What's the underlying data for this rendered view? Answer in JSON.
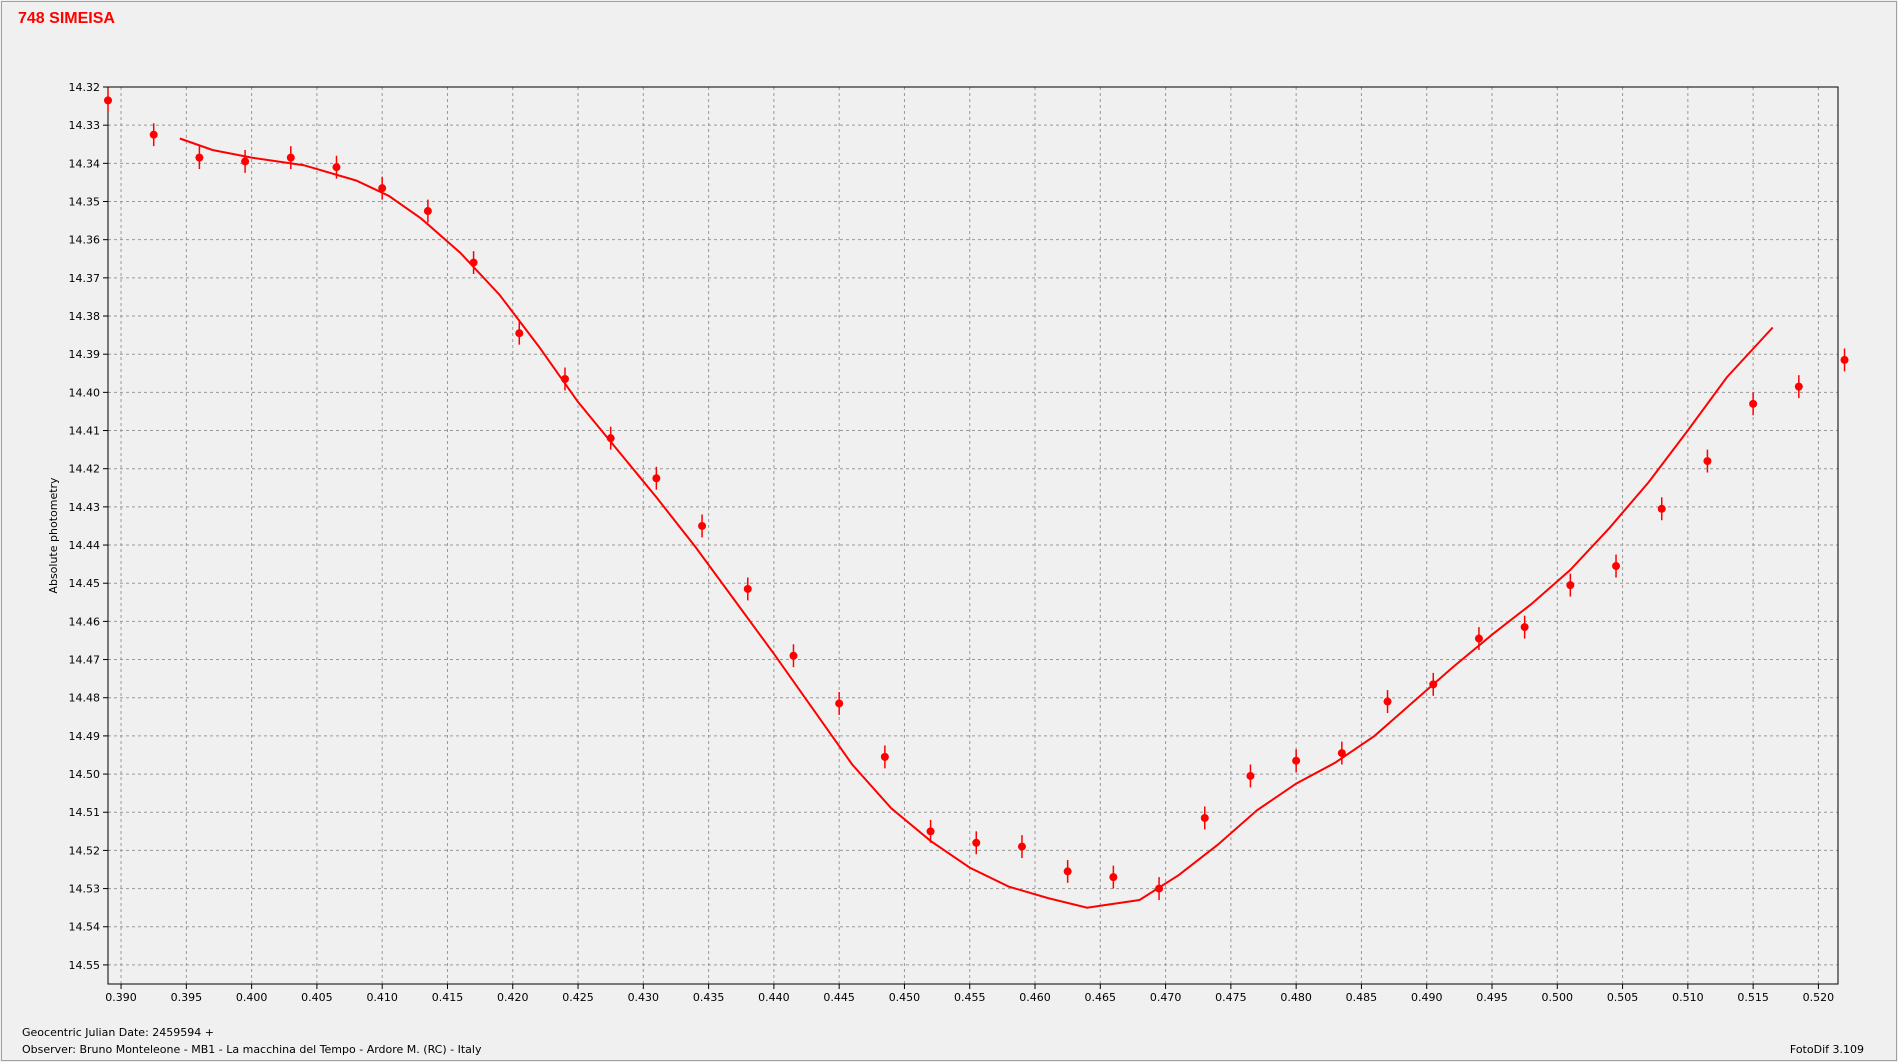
{
  "title": "748 SIMEISA",
  "footer": {
    "date_label": "Geocentric Julian Date: 2459594 +",
    "observer": "Observer: Bruno Monteleone - MB1 - La macchina del Tempo - Ardore M. (RC) - Italy",
    "software": "FotoDif 3.109"
  },
  "colors": {
    "series": "#ff0000",
    "grid": "#999999",
    "plot_bg": "#f0f0f0"
  },
  "chart_data": {
    "type": "scatter",
    "xlabel": "",
    "ylabel": "Absolute photometry",
    "xlim": [
      0.389,
      0.5215
    ],
    "ylim": [
      14.32,
      14.555
    ],
    "y_inverted": true,
    "grid": true,
    "x_ticks": [
      "0.390",
      "0.395",
      "0.400",
      "0.405",
      "0.410",
      "0.415",
      "0.420",
      "0.425",
      "0.430",
      "0.435",
      "0.440",
      "0.445",
      "0.450",
      "0.455",
      "0.460",
      "0.465",
      "0.470",
      "0.475",
      "0.480",
      "0.485",
      "0.490",
      "0.495",
      "0.500",
      "0.505",
      "0.510",
      "0.515",
      "0.520"
    ],
    "y_ticks": [
      "14.32",
      "14.33",
      "14.34",
      "14.35",
      "14.36",
      "14.37",
      "14.38",
      "14.39",
      "14.40",
      "14.41",
      "14.42",
      "14.43",
      "14.44",
      "14.45",
      "14.46",
      "14.47",
      "14.48",
      "14.49",
      "14.50",
      "14.51",
      "14.52",
      "14.53",
      "14.54",
      "14.55"
    ],
    "points": [
      {
        "x": 0.389,
        "y": 14.3235,
        "err": 0.003
      },
      {
        "x": 0.3925,
        "y": 14.3325,
        "err": 0.003
      },
      {
        "x": 0.396,
        "y": 14.3385,
        "err": 0.003
      },
      {
        "x": 0.3995,
        "y": 14.3395,
        "err": 0.003
      },
      {
        "x": 0.403,
        "y": 14.3385,
        "err": 0.003
      },
      {
        "x": 0.4065,
        "y": 14.341,
        "err": 0.003
      },
      {
        "x": 0.41,
        "y": 14.3465,
        "err": 0.003
      },
      {
        "x": 0.4135,
        "y": 14.3525,
        "err": 0.003
      },
      {
        "x": 0.417,
        "y": 14.366,
        "err": 0.003
      },
      {
        "x": 0.4205,
        "y": 14.3845,
        "err": 0.003
      },
      {
        "x": 0.424,
        "y": 14.3965,
        "err": 0.003
      },
      {
        "x": 0.4275,
        "y": 14.412,
        "err": 0.003
      },
      {
        "x": 0.431,
        "y": 14.4225,
        "err": 0.003
      },
      {
        "x": 0.4345,
        "y": 14.435,
        "err": 0.003
      },
      {
        "x": 0.438,
        "y": 14.4515,
        "err": 0.003
      },
      {
        "x": 0.4415,
        "y": 14.469,
        "err": 0.003
      },
      {
        "x": 0.445,
        "y": 14.4815,
        "err": 0.003
      },
      {
        "x": 0.4485,
        "y": 14.4955,
        "err": 0.003
      },
      {
        "x": 0.452,
        "y": 14.515,
        "err": 0.003
      },
      {
        "x": 0.4555,
        "y": 14.518,
        "err": 0.003
      },
      {
        "x": 0.459,
        "y": 14.519,
        "err": 0.003
      },
      {
        "x": 0.4625,
        "y": 14.5255,
        "err": 0.003
      },
      {
        "x": 0.466,
        "y": 14.527,
        "err": 0.003
      },
      {
        "x": 0.4695,
        "y": 14.53,
        "err": 0.003
      },
      {
        "x": 0.473,
        "y": 14.5115,
        "err": 0.003
      },
      {
        "x": 0.4765,
        "y": 14.5005,
        "err": 0.003
      },
      {
        "x": 0.48,
        "y": 14.4965,
        "err": 0.003
      },
      {
        "x": 0.4835,
        "y": 14.4945,
        "err": 0.003
      },
      {
        "x": 0.487,
        "y": 14.481,
        "err": 0.003
      },
      {
        "x": 0.4905,
        "y": 14.4765,
        "err": 0.003
      },
      {
        "x": 0.494,
        "y": 14.4645,
        "err": 0.003
      },
      {
        "x": 0.4975,
        "y": 14.4615,
        "err": 0.003
      },
      {
        "x": 0.501,
        "y": 14.4505,
        "err": 0.003
      },
      {
        "x": 0.5045,
        "y": 14.4455,
        "err": 0.003
      },
      {
        "x": 0.508,
        "y": 14.4305,
        "err": 0.003
      },
      {
        "x": 0.5115,
        "y": 14.418,
        "err": 0.003
      },
      {
        "x": 0.515,
        "y": 14.403,
        "err": 0.003
      },
      {
        "x": 0.5185,
        "y": 14.3985,
        "err": 0.003
      },
      {
        "x": 0.522,
        "y": 14.3915,
        "err": 0.003
      }
    ],
    "fit": {
      "x": [
        0.3945,
        0.397,
        0.4,
        0.404,
        0.408,
        0.4105,
        0.413,
        0.416,
        0.419,
        0.422,
        0.425,
        0.428,
        0.431,
        0.434,
        0.437,
        0.44,
        0.443,
        0.446,
        0.449,
        0.452,
        0.455,
        0.458,
        0.461,
        0.464,
        0.465,
        0.468,
        0.471,
        0.474,
        0.477,
        0.48,
        0.483,
        0.486,
        0.489,
        0.492,
        0.495,
        0.498,
        0.501,
        0.504,
        0.507,
        0.51,
        0.513,
        0.5165
      ],
      "y": [
        14.3335,
        14.3365,
        14.3385,
        14.3405,
        14.3445,
        14.3485,
        14.3545,
        14.3635,
        14.3745,
        14.388,
        14.4025,
        14.415,
        14.4275,
        14.4405,
        14.4545,
        14.4685,
        14.483,
        14.4975,
        14.509,
        14.5175,
        14.5245,
        14.5295,
        14.5325,
        14.535,
        14.5345,
        14.533,
        14.5265,
        14.5185,
        14.5095,
        14.5025,
        14.497,
        14.49,
        14.481,
        14.472,
        14.4635,
        14.4555,
        14.4465,
        14.4355,
        14.4235,
        14.41,
        14.396,
        14.383
      ]
    }
  }
}
